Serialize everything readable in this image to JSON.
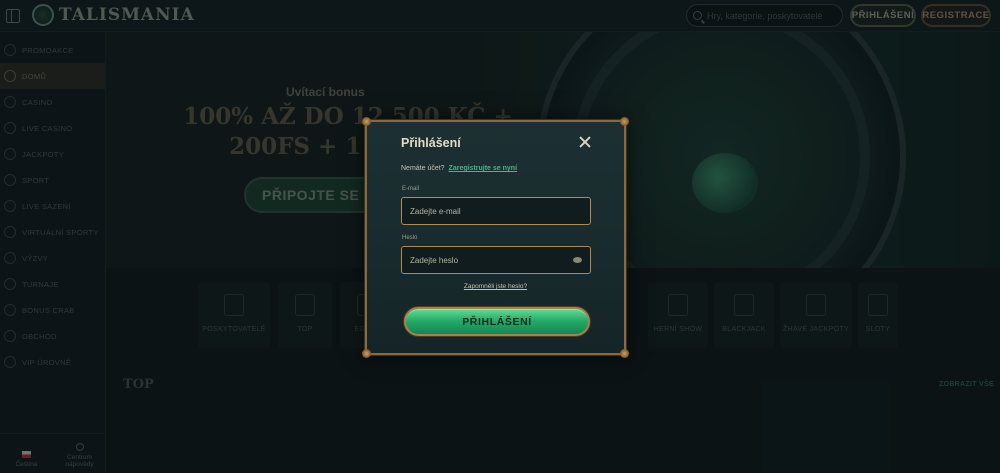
{
  "header": {
    "brand": "TALISMANIA",
    "search_placeholder": "Hry, kategorie, poskytovatelé",
    "login_label": "PŘIHLÁŠENÍ",
    "register_label": "REGISTRACE"
  },
  "sidebar": {
    "items": [
      {
        "label": "PROMOAKCE"
      },
      {
        "label": "DOMŮ"
      },
      {
        "label": "CASINO"
      },
      {
        "label": "LIVE CASINO"
      },
      {
        "label": "JACKPOTY"
      },
      {
        "label": "SPORT"
      },
      {
        "label": "LIVE SÁZENÍ"
      },
      {
        "label": "VIRTUÁLNÍ SPORTY"
      },
      {
        "label": "VÝZVY"
      },
      {
        "label": "TURNAJE"
      },
      {
        "label": "BONUS CRAB"
      },
      {
        "label": "OBCHOD"
      },
      {
        "label": "VIP ÚROVNĚ"
      }
    ],
    "active_index": 1,
    "footer": {
      "language": "Čeština",
      "help": "Centrum nápovědy"
    }
  },
  "banner": {
    "subtitle": "Uvítací bonus",
    "title_line1": "100% AŽ DO 12 500 KČ +",
    "title_line2": "200FS + 1 BONUS",
    "cta": "PŘIPOJTE SE"
  },
  "categories": [
    {
      "label": "POSKYTOVATELÉ",
      "icon": "providers-icon"
    },
    {
      "label": "TOP",
      "icon": "top-icon"
    },
    {
      "label": "EGYPT",
      "icon": "egypt-icon"
    },
    {
      "label": "HERNÍ SHOW",
      "icon": "game-show-icon"
    },
    {
      "label": "BLACKJACK",
      "icon": "blackjack-icon"
    },
    {
      "label": "ŽHAVÉ JACKPOTY",
      "icon": "hot-jackpots-icon"
    },
    {
      "label": "SLOTY",
      "icon": "slots-icon"
    }
  ],
  "section": {
    "title": "TOP",
    "show_all": "ZOBRAZIT VŠE"
  },
  "modal": {
    "title": "Přihlášení",
    "no_account_text": "Nemáte účet?",
    "register_link": "Zaregistrujte se nyní",
    "email_label": "E-mail",
    "email_placeholder": "Zadejte e-mail",
    "password_label": "Heslo",
    "password_placeholder": "Zadejte heslo",
    "forgot_link": "Zapomněli jste heslo?",
    "submit_label": "PŘIHLÁŠENÍ"
  },
  "colors": {
    "accent_green": "#23a865",
    "gold_border": "#8a6a3c",
    "background": "#0f1b1d"
  }
}
